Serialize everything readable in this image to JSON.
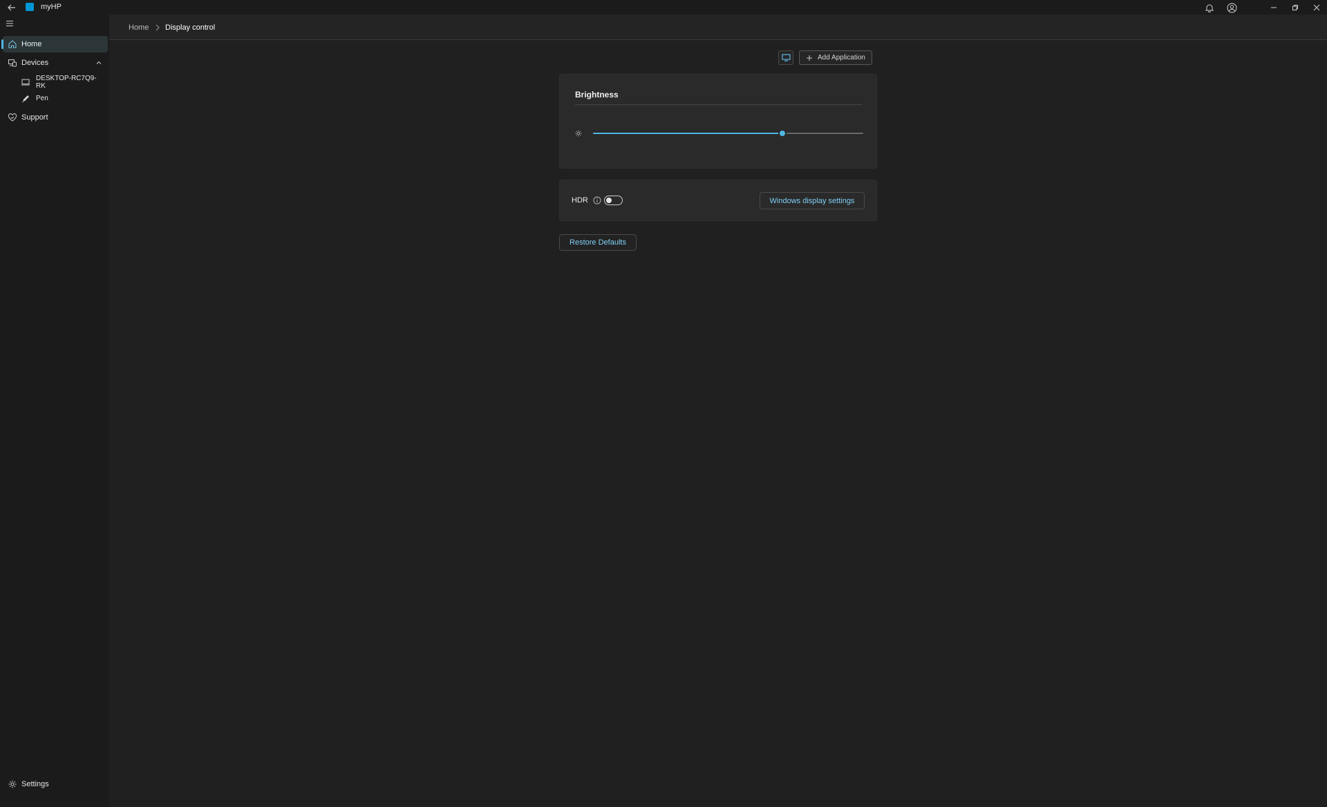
{
  "app": {
    "title": "myHP"
  },
  "sidebar": {
    "items": [
      {
        "label": "Home",
        "icon": "home-icon",
        "active": true
      },
      {
        "label": "Devices",
        "icon": "devices-icon"
      },
      {
        "label": "Support",
        "icon": "support-icon"
      }
    ],
    "devices": [
      {
        "label": "DESKTOP-RC7Q9-RK",
        "icon": "laptop-icon"
      },
      {
        "label": "Pen",
        "icon": "pen-icon"
      }
    ],
    "settings_label": "Settings"
  },
  "breadcrumb": {
    "home": "Home",
    "current": "Display control"
  },
  "toolbar": {
    "add_application_label": "Add Application"
  },
  "brightness": {
    "title": "Brightness",
    "value_percent": 70
  },
  "hdr": {
    "label": "HDR",
    "enabled": false,
    "windows_settings_label": "Windows display settings"
  },
  "restore_defaults_label": "Restore Defaults",
  "colors": {
    "accent": "#4fb7e6",
    "link": "#7fcff6",
    "background": "#202020",
    "card": "#2a2a2a"
  }
}
